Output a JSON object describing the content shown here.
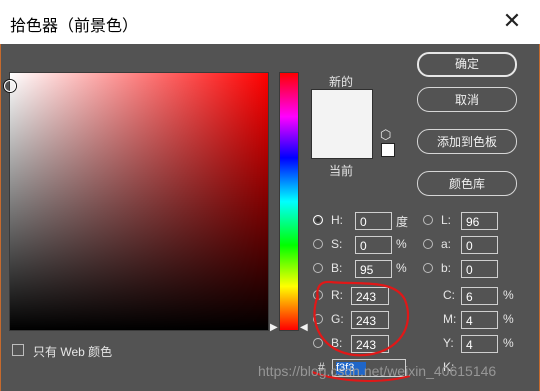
{
  "window": {
    "title": "拾色器（前景色）"
  },
  "preview": {
    "new_label": "新的",
    "current_label": "当前",
    "color": "#f3f3f3"
  },
  "buttons": {
    "ok": "确定",
    "cancel": "取消",
    "add_swatch": "添加到色板",
    "color_library": "颜色库"
  },
  "hsb": {
    "h_label": "H:",
    "h_value": "0",
    "h_unit": "度",
    "s_label": "S:",
    "s_value": "0",
    "s_unit": "%",
    "b_label": "B:",
    "b_value": "95",
    "b_unit": "%"
  },
  "lab": {
    "l_label": "L:",
    "l_value": "96",
    "a_label": "a:",
    "a_value": "0",
    "b_label": "b:",
    "b_value": "0"
  },
  "rgb": {
    "r_label": "R:",
    "r_value": "243",
    "g_label": "G:",
    "g_value": "243",
    "b_label": "B:",
    "b_value": "243"
  },
  "cmyk": {
    "c_label": "C:",
    "c_value": "6",
    "m_label": "M:",
    "m_value": "4",
    "y_label": "Y:",
    "y_value": "4",
    "k_label": "K:",
    "unit": "%"
  },
  "hex": {
    "prefix": "#",
    "value": "f3f3f3",
    "selected": "f3f3"
  },
  "web_only": {
    "label": "只有 Web 颜色"
  },
  "watermark": "https://blog.csdn.net/weixin_40615146",
  "icons": {
    "close": "close-icon",
    "cube": "web-safe-cube-icon"
  }
}
